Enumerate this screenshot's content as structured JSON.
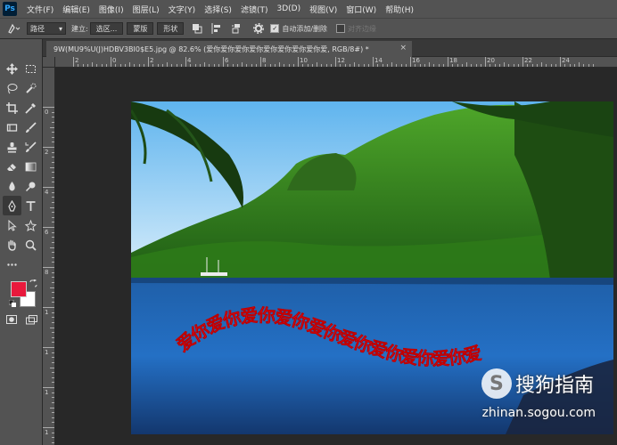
{
  "app": {
    "logo": "Ps"
  },
  "menu": {
    "items": [
      "文件(F)",
      "编辑(E)",
      "图像(I)",
      "图层(L)",
      "文字(Y)",
      "选择(S)",
      "滤镜(T)",
      "3D(D)",
      "视图(V)",
      "窗口(W)",
      "帮助(H)"
    ]
  },
  "options": {
    "tool_icon": "pen-tool-icon",
    "mode_select": "路径",
    "make_label": "建立:",
    "selection_button": "选区...",
    "mask_button": "蒙版",
    "shape_button": "形状",
    "auto_add_delete": "自动添加/删除",
    "auto_add_delete_checked": true,
    "align_edges": "对齐边缘",
    "align_edges_checked": false
  },
  "document": {
    "tab_title": "9W(MU9%U(J)HDBV3BI0$E5.jpg @ 82.6% (爱你爱你爱你爱你爱你爱你爱你爱你爱, RGB/8#) *",
    "close": "×"
  },
  "rulers": {
    "top": [
      "2",
      "0",
      "2",
      "4",
      "6",
      "8",
      "10",
      "12",
      "14",
      "16",
      "18",
      "20",
      "22",
      "24"
    ],
    "left": [
      "0",
      "2",
      "4",
      "6",
      "8",
      "1",
      "1",
      "1",
      "1"
    ]
  },
  "image_text": {
    "path_text": "爱你爱你爱你爱你爱你爱你爱你爱你爱你爱",
    "color": "#e8193c"
  },
  "colors": {
    "foreground": "#e8193c",
    "background": "#ffffff",
    "accent": "#31a8ff"
  },
  "watermark": {
    "logo": "S",
    "name": "搜狗指南",
    "url": "zhinan.sogou.com"
  }
}
